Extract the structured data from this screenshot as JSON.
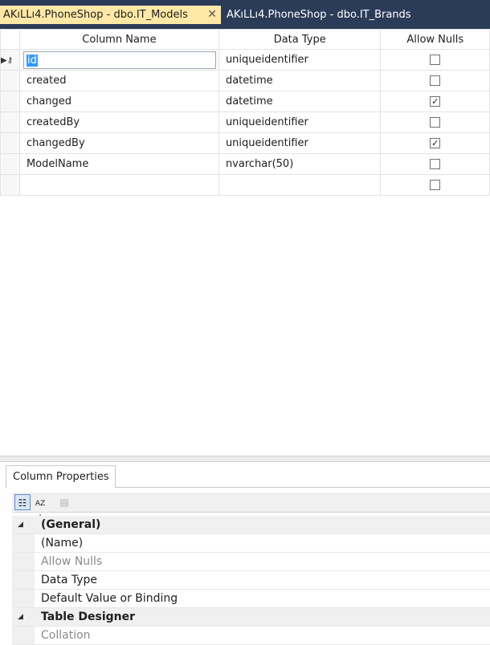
{
  "tabs": [
    {
      "label": "AKıLLı4.PhoneShop - dbo.IT_Models",
      "active": true,
      "close": "✕"
    },
    {
      "label": "AKıLLı4.PhoneShop - dbo.IT_Brands",
      "active": false
    }
  ],
  "grid": {
    "headers": [
      "Column Name",
      "Data Type",
      "Allow Nulls"
    ],
    "rows": [
      {
        "name": "id",
        "type": "uniqueidentifier",
        "allow_nulls": false,
        "primary_key": true,
        "editing": true
      },
      {
        "name": "created",
        "type": "datetime",
        "allow_nulls": false
      },
      {
        "name": "changed",
        "type": "datetime",
        "allow_nulls": true
      },
      {
        "name": "createdBy",
        "type": "uniqueidentifier",
        "allow_nulls": false
      },
      {
        "name": "changedBy",
        "type": "uniqueidentifier",
        "allow_nulls": true
      },
      {
        "name": "ModelName",
        "type": "nvarchar(50)",
        "allow_nulls": false
      },
      {
        "name": "",
        "type": "",
        "allow_nulls": false
      }
    ]
  },
  "properties": {
    "tab_label": "Column Properties",
    "toolbar": [
      "categorized-icon",
      "alphabetical-icon",
      "property-pages-icon"
    ],
    "rows": [
      {
        "label": "(General)",
        "kind": "category"
      },
      {
        "label": "(Name)",
        "kind": "item"
      },
      {
        "label": "Allow Nulls",
        "kind": "disabled"
      },
      {
        "label": "Data Type",
        "kind": "item"
      },
      {
        "label": "Default Value or Binding",
        "kind": "item"
      },
      {
        "label": "Table Designer",
        "kind": "category"
      },
      {
        "label": "Collation",
        "kind": "disabled"
      }
    ]
  },
  "colors": {
    "tab_strip": "#2b3c59",
    "active_tab": "#ffe8a6",
    "selection": "#3399ff"
  }
}
